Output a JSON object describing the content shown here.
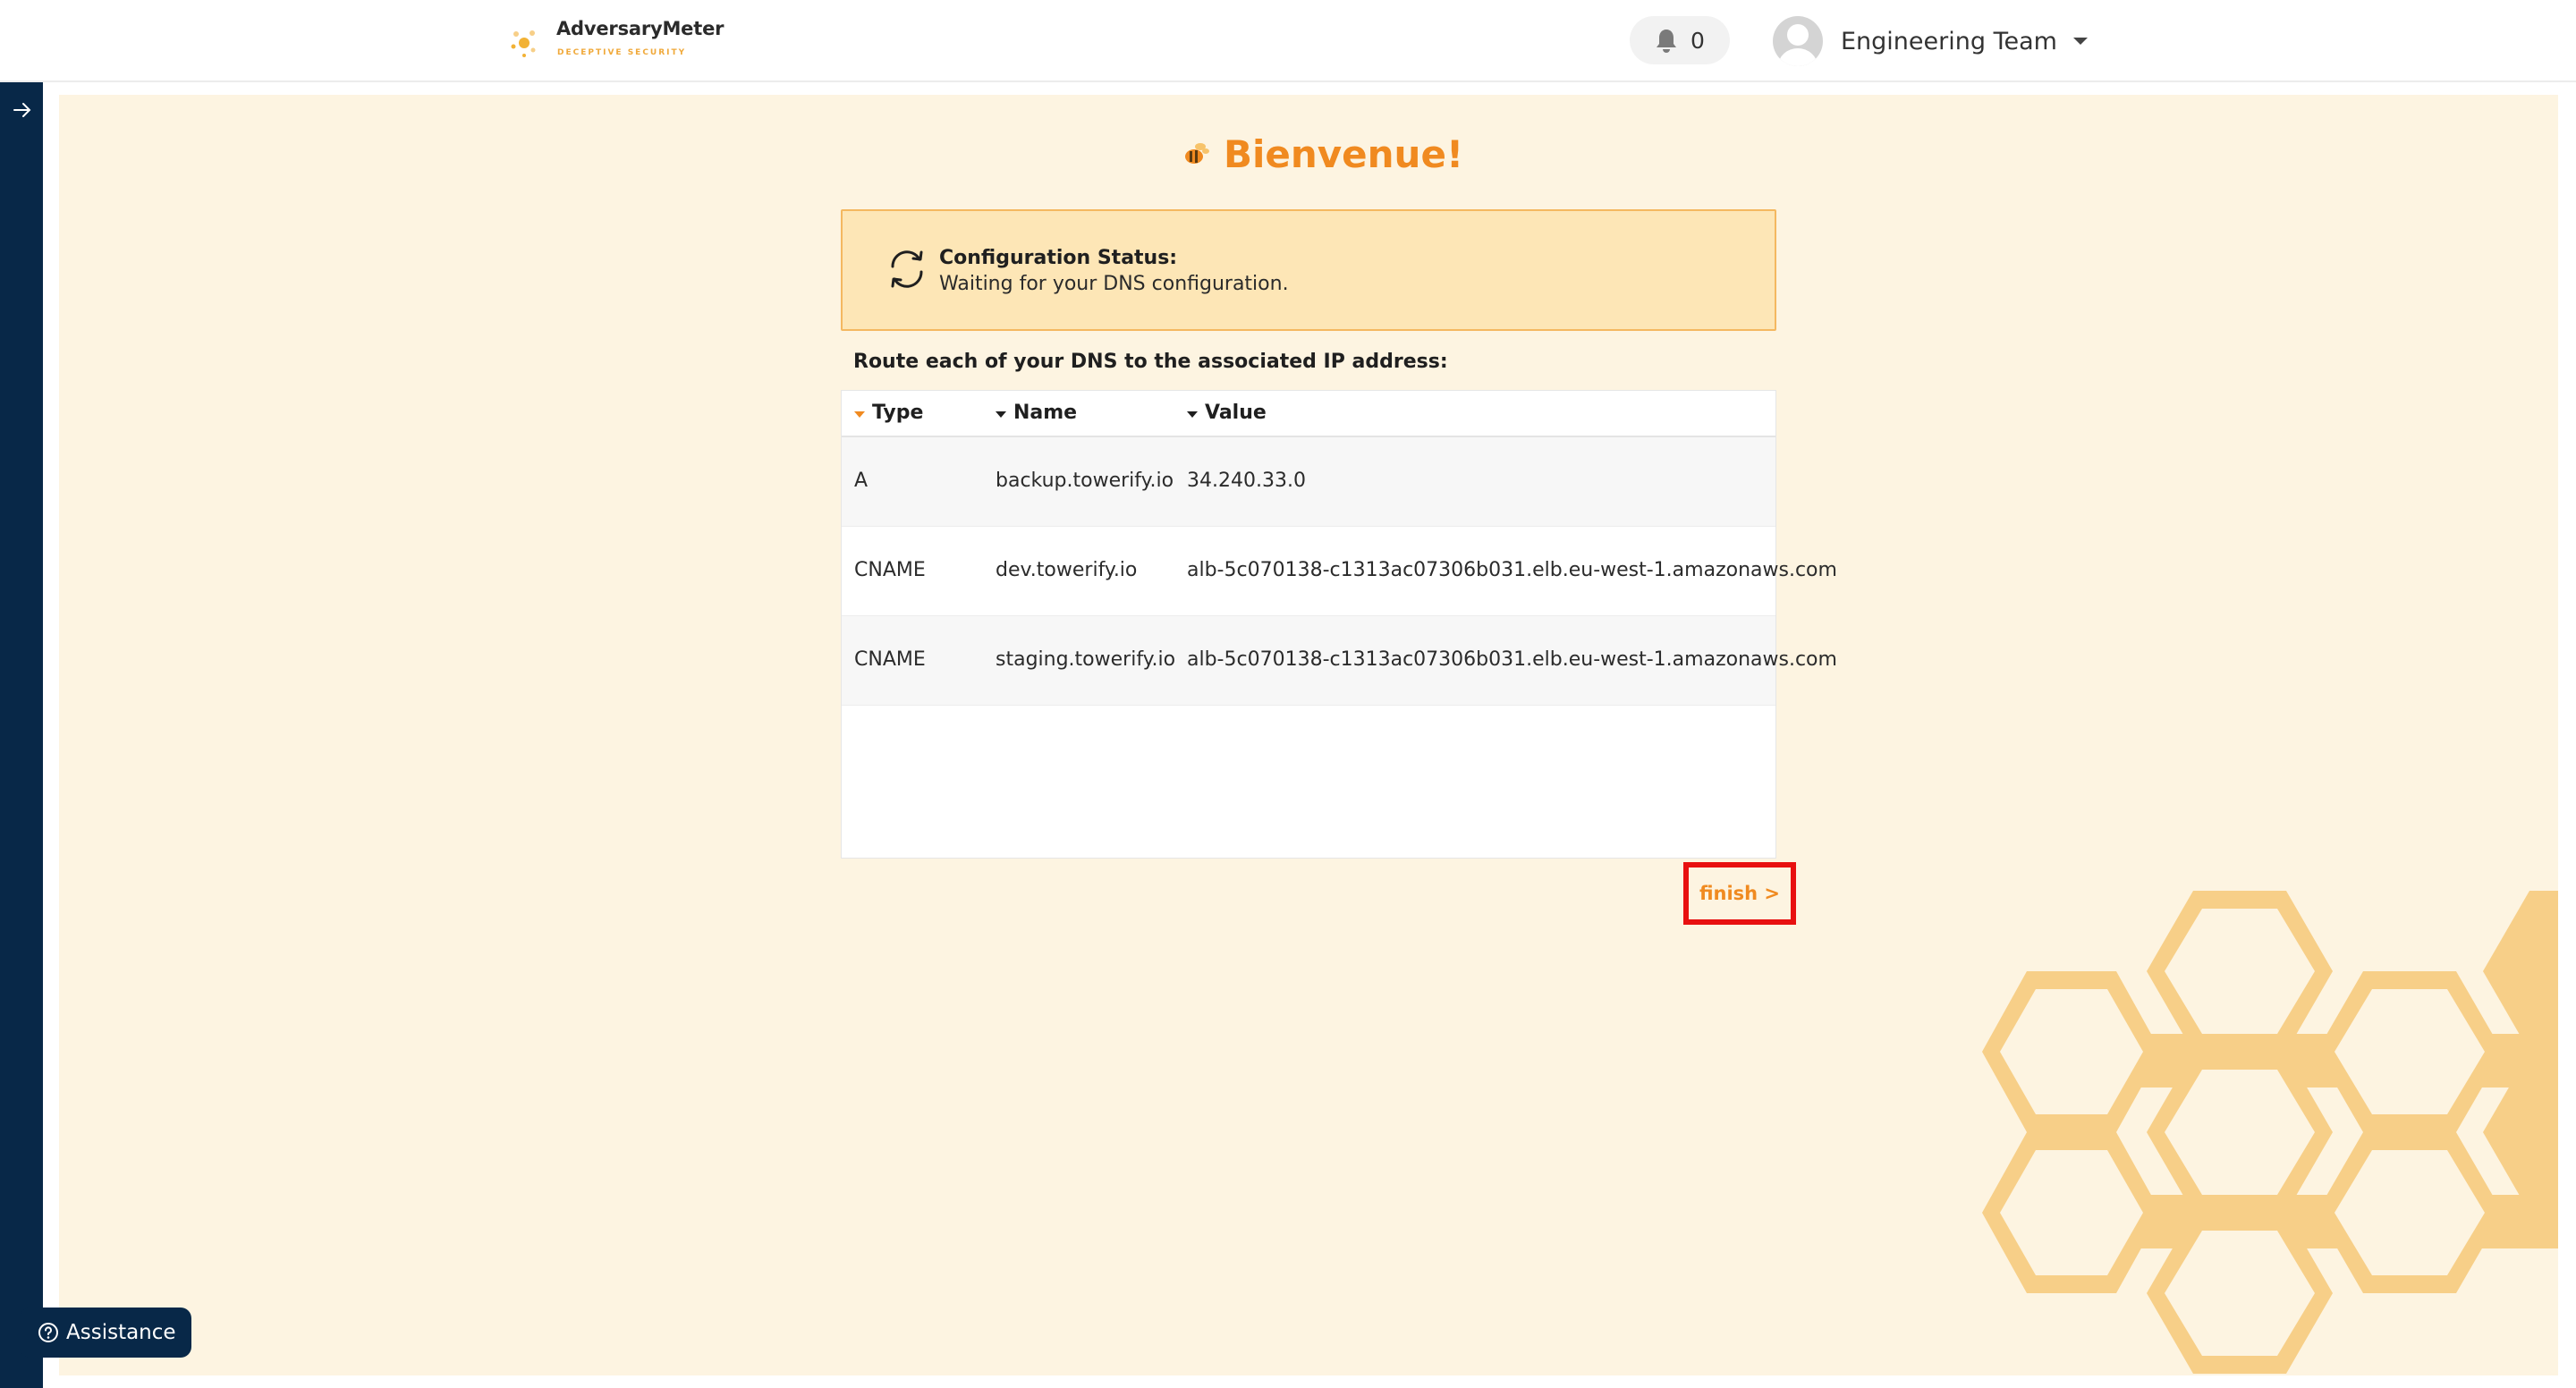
{
  "header": {
    "brand_name": "AdversaryMeter",
    "brand_tagline": "DECEPTIVE SECURITY",
    "notification_count": "0",
    "user_name": "Engineering Team"
  },
  "page": {
    "title": "Bienvenue!"
  },
  "status": {
    "label": "Configuration Status:",
    "message": "Waiting for your DNS configuration."
  },
  "instruction": "Route each of your DNS to the associated IP address:",
  "table": {
    "columns": [
      "Type",
      "Name",
      "Value"
    ],
    "rows": [
      {
        "type": "A",
        "name": "backup.towerify.io",
        "value": "34.240.33.0"
      },
      {
        "type": "CNAME",
        "name": "dev.towerify.io",
        "value": "alb-5c070138-c1313ac07306b031.elb.eu-west-1.amazonaws.com"
      },
      {
        "type": "CNAME",
        "name": "staging.towerify.io",
        "value": "alb-5c070138-c1313ac07306b031.elb.eu-west-1.amazonaws.com"
      }
    ]
  },
  "actions": {
    "finish_label": "finish >"
  },
  "assistance": {
    "label": "Assistance"
  },
  "colors": {
    "accent_orange": "#f08a20",
    "sidebar_navy": "#082848",
    "content_background": "#fdf4e1",
    "status_background": "#fde6b6",
    "honeycomb": "#f7cf88",
    "highlight_red": "#e81010"
  },
  "icons": {
    "brand": "bee-logo-icon",
    "notification": "bell-icon",
    "avatar": "user-avatar-icon",
    "sidebar_toggle": "arrow-right-icon",
    "title": "bee-icon",
    "status": "refresh-icon",
    "assistance": "question-circle-icon"
  }
}
